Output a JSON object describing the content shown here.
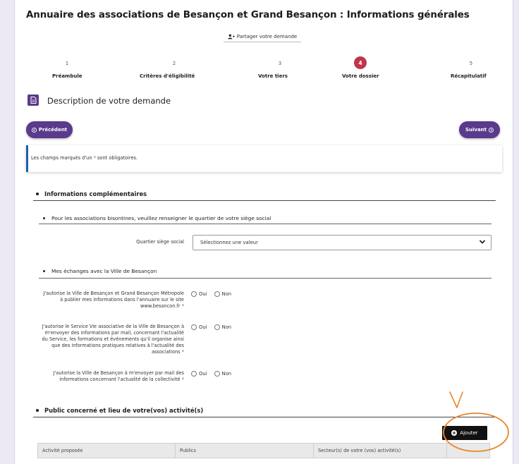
{
  "header": {
    "title": "Annuaire des associations de Besançon et Grand Besançon : Informations générales",
    "share_label": "Partager votre demande"
  },
  "steps": [
    {
      "num": "1",
      "label": "Préambule"
    },
    {
      "num": "2",
      "label": "Critères d'éligibilité"
    },
    {
      "num": "3",
      "label": "Votre tiers"
    },
    {
      "num": "4",
      "label": "Votre dossier",
      "active": true
    },
    {
      "num": "5",
      "label": "Récapitulatif"
    }
  ],
  "section": {
    "title": "Description de votre demande"
  },
  "nav": {
    "previous_label": "Précédent",
    "next_label": "Suivant"
  },
  "notice": {
    "prefix": "Les champs marqués d'un ",
    "star": "*",
    "suffix": " sont obligatoires."
  },
  "info_complementaires": {
    "heading": "Informations complémentaires",
    "quartier": {
      "heading": "Pour les associations bisontines, veuillez renseigner le quartier de votre siège social",
      "label": "Quartier siège social",
      "select_value": "Sélectionnez une valeur"
    },
    "echanges": {
      "heading": "Mes échanges avec la Ville de Besançon",
      "questions": [
        {
          "label": "J'autorise la Ville de Besançon et Grand Besançon Métropole à publier mes informations dans l'annuaire sur le site www.besancon.fr"
        },
        {
          "label": "J'autorise le Service Vie associative de la Ville de Besançon à m'envoyer des informations par mail, concernant l'actualité du Service, les formations et événements qu'il organise ainsi que des informations pratiques relatives à l'actualité des associations"
        },
        {
          "label": "J'autorise la Ville de Besançon à m'envoyer par mail des informations concernant l'actualité de la collectivité"
        }
      ],
      "option_yes": "Oui",
      "option_no": "Non",
      "required_mark": "*"
    }
  },
  "public": {
    "heading": "Public concerné et lieu de votre(vos) activité(s)",
    "add_label": "Ajouter",
    "columns": [
      "Activité proposée",
      "Publics",
      "Secteur(s) de votre (vos) activité(s)",
      ""
    ]
  },
  "colors": {
    "accent": "#5a3a8c",
    "active_step": "#c0354a",
    "annotation": "#e8862a",
    "notice_border": "#1f5fa8"
  }
}
